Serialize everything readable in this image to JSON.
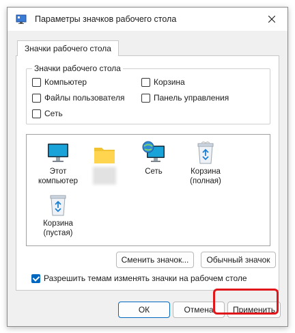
{
  "window": {
    "title": "Параметры значков рабочего стола",
    "title_icon": "desktop-settings-icon"
  },
  "tab": {
    "label": "Значки рабочего стола"
  },
  "group": {
    "legend": "Значки рабочего стола",
    "checkboxes": [
      {
        "label": "Компьютер",
        "checked": false
      },
      {
        "label": "Корзина",
        "checked": false
      },
      {
        "label": "Файлы пользователя",
        "checked": false
      },
      {
        "label": "Панель управления",
        "checked": false
      },
      {
        "label": "Сеть",
        "checked": false
      }
    ]
  },
  "icons": [
    {
      "label": "Этот компьютер",
      "icon": "monitor-icon"
    },
    {
      "label": "",
      "icon": "folder-icon"
    },
    {
      "label": "Сеть",
      "icon": "network-icon"
    },
    {
      "label": "Корзина (полная)",
      "icon": "recycle-bin-full-icon"
    },
    {
      "label": "Корзина (пустая)",
      "icon": "recycle-bin-empty-icon"
    }
  ],
  "buttons": {
    "change_icon": "Сменить значок...",
    "default_icon": "Обычный значок",
    "ok": "ОК",
    "cancel": "Отмена",
    "apply": "Применить"
  },
  "themes_checkbox": {
    "label": "Разрешить темам изменять значки на рабочем столе",
    "checked": true
  },
  "colors": {
    "accent": "#0067c0",
    "highlight": "#e0161a"
  }
}
